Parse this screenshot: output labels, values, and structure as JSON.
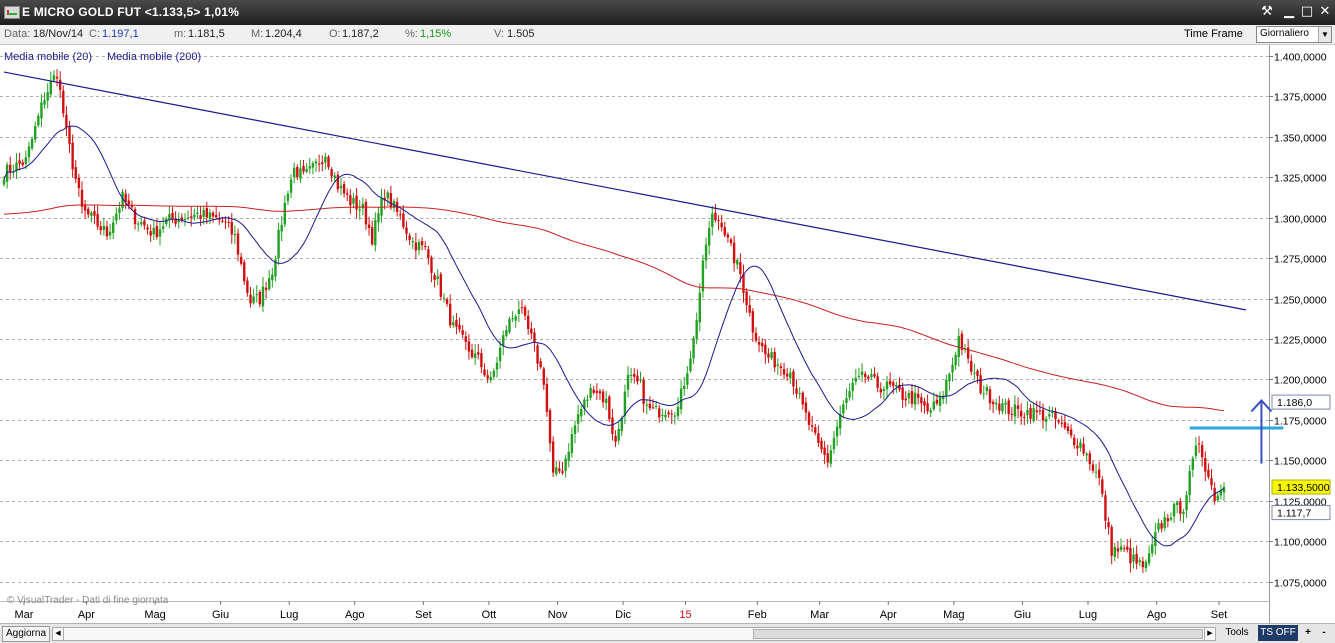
{
  "window": {
    "title": "E MICRO GOLD FUT <1.133,5> 1,01%",
    "buttons": [
      "tools",
      "minimize",
      "maximize",
      "close"
    ]
  },
  "infobar": {
    "data_label": "Data:",
    "data_value": "18/Nov/14",
    "c_label": "C:",
    "c_value": "1.197,1",
    "m_label": "m:",
    "m_value": "1.181,5",
    "M_label": "M:",
    "M_value": "1.204,4",
    "o_label": "O:",
    "o_value": "1.187,2",
    "pct_label": "%:",
    "pct_value": "1,15%",
    "v_label": "V:",
    "v_value": "1.505",
    "time_frame_label": "Time Frame",
    "time_frame_value": "Giornaliero"
  },
  "legend": {
    "ma20": "Media mobile (20)",
    "ma200": "Media mobile (200)"
  },
  "watermark": "© VisualTrader - Dati di fine giornata",
  "price_tags": {
    "ma200": "1.186,0",
    "last": "1.133,5000",
    "ma20": "1.117,7"
  },
  "bottombar": {
    "aggiorna": "Aggiorna",
    "tools": "Tools",
    "ts_off": "TS OFF",
    "plus": "+",
    "minus": "-"
  },
  "colors": {
    "up": "#22a022",
    "down": "#d01010",
    "ma20": "#1a1a8c",
    "ma200": "#c82020",
    "trendline": "#1a1a8c",
    "resistance": "#2aa6e0",
    "arrow": "#3a4fc0",
    "last_tag_bg": "#f6f600"
  },
  "chart_data": {
    "type": "candlestick",
    "title": "E MICRO GOLD FUT",
    "x_ticks": [
      "Mar",
      "Apr",
      "Mag",
      "Giu",
      "Lug",
      "Ago",
      "Set",
      "Ott",
      "Nov",
      "Dic",
      "15",
      "Feb",
      "Mar",
      "Apr",
      "Mag",
      "Giu",
      "Lug",
      "Ago",
      "Set"
    ],
    "x_tick_highlight": "15",
    "y_ticks": [
      "1.400,0000",
      "1.375,0000",
      "1.350,0000",
      "1.325,0000",
      "1.300,0000",
      "1.275,0000",
      "1.250,0000",
      "1.225,0000",
      "1.200,0000",
      "1.175,0000",
      "1.150,0000",
      "1.125,0000",
      "1.100,0000",
      "1.075,0000"
    ],
    "ylim": [
      1068,
      1403
    ],
    "grid": "horizontal dotted",
    "close_path": [
      [
        0,
        1328
      ],
      [
        7,
        1335
      ],
      [
        13,
        1375
      ],
      [
        17,
        1390
      ],
      [
        20,
        1352
      ],
      [
        25,
        1305
      ],
      [
        33,
        1290
      ],
      [
        38,
        1312
      ],
      [
        42,
        1300
      ],
      [
        48,
        1290
      ],
      [
        52,
        1298
      ],
      [
        57,
        1300
      ],
      [
        62,
        1302
      ],
      [
        66,
        1300
      ],
      [
        70,
        1298
      ],
      [
        74,
        1288
      ],
      [
        77,
        1262
      ],
      [
        79,
        1248
      ],
      [
        82,
        1250
      ],
      [
        86,
        1268
      ],
      [
        91,
        1318
      ],
      [
        93,
        1330
      ],
      [
        96,
        1325
      ],
      [
        99,
        1330
      ],
      [
        103,
        1340
      ],
      [
        107,
        1320
      ],
      [
        111,
        1310
      ],
      [
        115,
        1305
      ],
      [
        118,
        1288
      ],
      [
        122,
        1315
      ],
      [
        127,
        1300
      ],
      [
        131,
        1285
      ],
      [
        135,
        1280
      ],
      [
        139,
        1260
      ],
      [
        144,
        1232
      ],
      [
        149,
        1218
      ],
      [
        152,
        1212
      ],
      [
        156,
        1198
      ],
      [
        161,
        1232
      ],
      [
        165,
        1245
      ],
      [
        169,
        1225
      ],
      [
        173,
        1200
      ],
      [
        176,
        1140
      ],
      [
        179,
        1145
      ],
      [
        184,
        1178
      ],
      [
        189,
        1196
      ],
      [
        193,
        1186
      ],
      [
        196,
        1160
      ],
      [
        200,
        1200
      ],
      [
        204,
        1196
      ],
      [
        206,
        1182
      ],
      [
        209,
        1180
      ],
      [
        212,
        1182
      ],
      [
        216,
        1182
      ],
      [
        221,
        1224
      ],
      [
        225,
        1284
      ],
      [
        227,
        1300
      ],
      [
        230,
        1298
      ],
      [
        232,
        1285
      ],
      [
        234,
        1275
      ],
      [
        236,
        1265
      ],
      [
        240,
        1232
      ],
      [
        244,
        1215
      ],
      [
        248,
        1210
      ],
      [
        252,
        1205
      ],
      [
        256,
        1182
      ],
      [
        261,
        1158
      ],
      [
        264,
        1150
      ],
      [
        268,
        1178
      ],
      [
        272,
        1196
      ],
      [
        276,
        1202
      ],
      [
        280,
        1196
      ],
      [
        284,
        1195
      ],
      [
        288,
        1190
      ],
      [
        292,
        1188
      ],
      [
        296,
        1180
      ],
      [
        300,
        1186
      ],
      [
        304,
        1210
      ],
      [
        306,
        1226
      ],
      [
        309,
        1210
      ],
      [
        313,
        1195
      ],
      [
        317,
        1188
      ],
      [
        321,
        1182
      ],
      [
        325,
        1180
      ],
      [
        329,
        1180
      ],
      [
        333,
        1178
      ],
      [
        337,
        1175
      ],
      [
        341,
        1166
      ],
      [
        345,
        1160
      ],
      [
        348,
        1150
      ],
      [
        351,
        1138
      ],
      [
        353,
        1115
      ],
      [
        355,
        1095
      ],
      [
        359,
        1094
      ],
      [
        363,
        1086
      ],
      [
        366,
        1084
      ],
      [
        370,
        1108
      ],
      [
        374,
        1118
      ],
      [
        378,
        1122
      ],
      [
        381,
        1148
      ],
      [
        383,
        1162
      ],
      [
        386,
        1140
      ],
      [
        388,
        1128
      ],
      [
        391,
        1133.5
      ]
    ],
    "candles_count": 392,
    "series": [
      {
        "name": "Media mobile (20)",
        "type": "moving-average",
        "period": 20,
        "last": 1117.7
      },
      {
        "name": "Media mobile (200)",
        "type": "moving-average",
        "period": 200,
        "last": 1186.0
      }
    ],
    "trendline": {
      "from": [
        0,
        1390
      ],
      "to": [
        398,
        1243
      ]
    },
    "resistance": {
      "x_from": 380,
      "x_to": 410,
      "y": 1170
    },
    "arrow": {
      "x": 403,
      "y_from": 1148,
      "y_to": 1187
    },
    "last_price": 1133.5
  }
}
